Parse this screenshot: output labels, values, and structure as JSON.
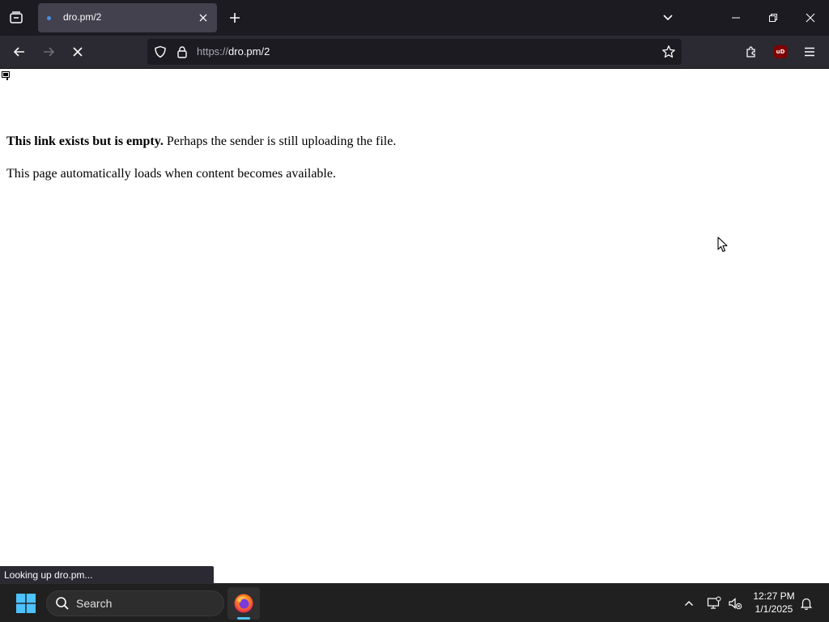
{
  "browser": {
    "tab": {
      "title": "dro.pm/2"
    },
    "url": {
      "scheme": "https://",
      "host": "dro.pm/2"
    },
    "extension_badge": "uD"
  },
  "page": {
    "bold_text": "This link exists but is empty.",
    "line1_rest": " Perhaps the sender is still uploading the file.",
    "line2": "This page automatically loads when content becomes available."
  },
  "status": {
    "text": "Looking up dro.pm..."
  },
  "taskbar": {
    "search_label": "Search",
    "time": "12:27 PM",
    "date": "1/1/2025"
  },
  "colors": {
    "tabbar_bg": "#1c1b22",
    "navbar_bg": "#2b2a33",
    "taskbar_bg": "#202020",
    "windows_blue": "#4cc2ff"
  }
}
